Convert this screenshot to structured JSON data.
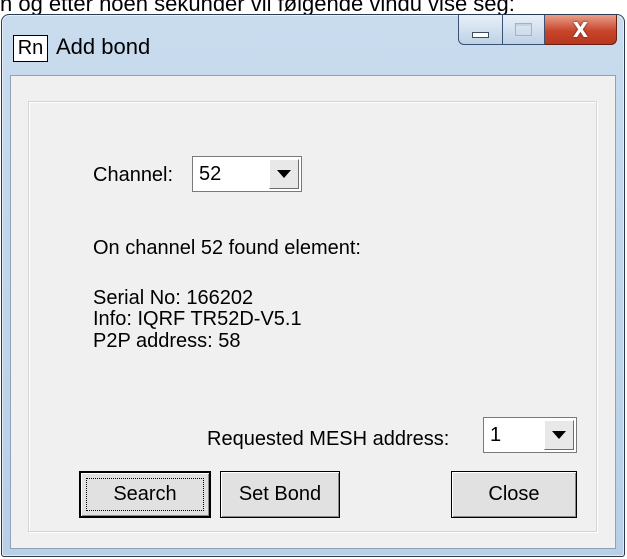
{
  "document": {
    "top_text": "n og etter noen sekunder vil følgende vindu vise seg:"
  },
  "window": {
    "app_icon_text": "Rn",
    "title": "Add bond",
    "controls": {
      "minimize_icon": "minimize-icon",
      "maximize_icon": "maximize-icon",
      "close_icon": "close-icon",
      "close_glyph": "X"
    }
  },
  "form": {
    "channel_label": "Channel:",
    "channel_value": "52",
    "found_text": "On channel 52 found element:",
    "serial_text": "Serial No: 166202",
    "info_text": "Info: IQRF TR52D-V5.1",
    "p2p_text": "P2P address: 58",
    "mesh_label": "Requested MESH address:",
    "mesh_value": "1"
  },
  "buttons": {
    "search": "Search",
    "set_bond": "Set Bond",
    "close": "Close"
  },
  "colors": {
    "close_button": "#c8452b",
    "client_bg": "#f0f0f0",
    "frame": "#b8cfe6"
  }
}
